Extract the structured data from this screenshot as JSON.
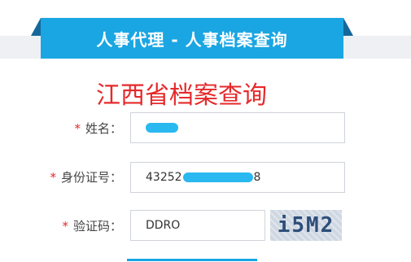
{
  "banner": {
    "title": "人事代理 - 人事档案查询"
  },
  "page": {
    "heading": "江西省档案查询"
  },
  "form": {
    "required_mark": "*",
    "name": {
      "label": "姓名：",
      "value": ""
    },
    "id_number": {
      "label": "身份证号：",
      "value_prefix": "43252",
      "value_suffix": "8"
    },
    "captcha": {
      "label": "验证码：",
      "value": "DDRO",
      "image_text": "i5M2"
    }
  },
  "colors": {
    "accent": "#1aa6e2",
    "heading": "#e5292b",
    "dark_blue": "#15679a"
  }
}
